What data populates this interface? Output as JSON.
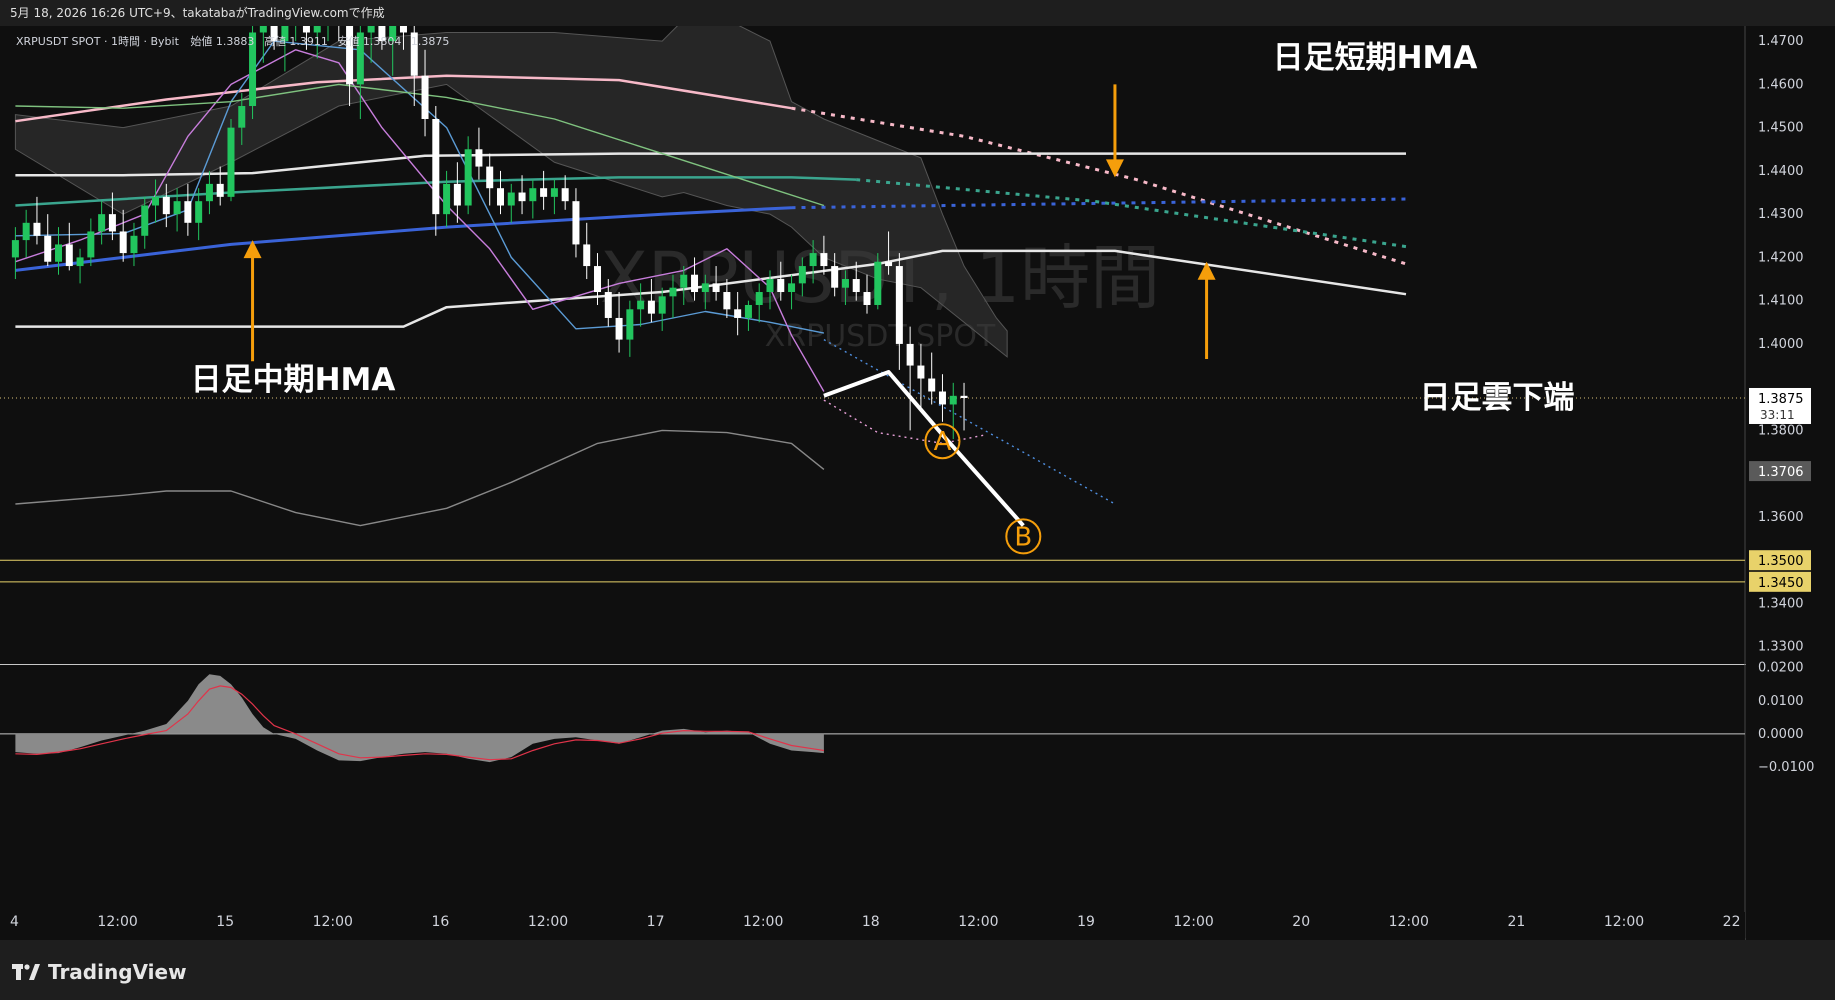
{
  "header": {
    "caption": "5月 18, 2026 16:26 UTC+9、takatabaがTradingView.comで作成",
    "legend_symbol": "XRPUSDT SPOT · 1時間 · Bybit",
    "legend_open_label": "始値",
    "legend_open": "1.3883",
    "legend_high_label": "高値",
    "legend_high": "1.3911",
    "legend_low_label": "安値",
    "legend_low": "1.3804",
    "legend_close": "1.3875"
  },
  "watermark": {
    "big": "XRPUSDT, 1時間",
    "small": "XRPUSDT SPOT"
  },
  "annotations": {
    "short_hma": "日足短期HMA",
    "mid_hma": "日足中期HMA",
    "cloud_bottom": "日足雲下端",
    "wave_a": "A",
    "wave_b": "B"
  },
  "brand": {
    "name": "TradingView"
  },
  "colors": {
    "background": "#0f0f0f",
    "up_candle": "#22c55e",
    "down_candle": "#ffffff",
    "short_hma": "#f7b9c8",
    "mid_hma": "#3a63d8",
    "teal_hma": "#3aa58e",
    "cloud": "#3a3a3a",
    "support": "#e8d26a",
    "arrow": "#f59e0b"
  },
  "chart_data": [
    {
      "type": "line",
      "title": "XRPUSDT, 1時間",
      "x_ticks": [
        "4",
        "12:00",
        "15",
        "12:00",
        "16",
        "12:00",
        "17",
        "12:00",
        "18",
        "12:00",
        "19",
        "12:00",
        "20",
        "12:00",
        "21",
        "12:00",
        "22"
      ],
      "y_ticks": [
        "1.4700",
        "1.4600",
        "1.4500",
        "1.4400",
        "1.4300",
        "1.4200",
        "1.4100",
        "1.4000",
        "1.3800",
        "1.3600",
        "1.3400",
        "1.3300"
      ],
      "ylim": [
        1.326,
        1.4735
      ],
      "price_labels": [
        {
          "value": 1.3875,
          "text": "1.3875",
          "sub": "33:11",
          "kind": "last"
        },
        {
          "value": 1.3706,
          "text": "1.3706",
          "kind": "gray"
        },
        {
          "value": 1.35,
          "text": "1.3500",
          "kind": "support"
        },
        {
          "value": 1.345,
          "text": "1.3450",
          "kind": "support"
        }
      ],
      "last_price": 1.3875,
      "support_levels": [
        1.35,
        1.345
      ],
      "candles": [
        [
          1.42,
          1.427,
          1.415,
          1.424
        ],
        [
          1.424,
          1.431,
          1.42,
          1.428
        ],
        [
          1.428,
          1.434,
          1.423,
          1.425
        ],
        [
          1.425,
          1.43,
          1.418,
          1.419
        ],
        [
          1.419,
          1.427,
          1.416,
          1.423
        ],
        [
          1.423,
          1.428,
          1.417,
          1.418
        ],
        [
          1.418,
          1.422,
          1.414,
          1.42
        ],
        [
          1.42,
          1.429,
          1.418,
          1.426
        ],
        [
          1.426,
          1.433,
          1.423,
          1.43
        ],
        [
          1.43,
          1.435,
          1.424,
          1.426
        ],
        [
          1.426,
          1.431,
          1.419,
          1.421
        ],
        [
          1.421,
          1.428,
          1.418,
          1.425
        ],
        [
          1.425,
          1.434,
          1.422,
          1.432
        ],
        [
          1.432,
          1.438,
          1.428,
          1.434
        ],
        [
          1.434,
          1.437,
          1.427,
          1.43
        ],
        [
          1.43,
          1.436,
          1.426,
          1.433
        ],
        [
          1.433,
          1.437,
          1.425,
          1.428
        ],
        [
          1.428,
          1.436,
          1.424,
          1.433
        ],
        [
          1.433,
          1.44,
          1.43,
          1.437
        ],
        [
          1.437,
          1.441,
          1.432,
          1.434
        ],
        [
          1.434,
          1.452,
          1.433,
          1.45
        ],
        [
          1.45,
          1.458,
          1.446,
          1.455
        ],
        [
          1.455,
          1.476,
          1.452,
          1.472
        ],
        [
          1.472,
          1.478,
          1.465,
          1.476
        ],
        [
          1.476,
          1.48,
          1.468,
          1.47
        ],
        [
          1.47,
          1.478,
          1.463,
          1.475
        ],
        [
          1.475,
          1.482,
          1.47,
          1.478
        ],
        [
          1.478,
          1.482,
          1.468,
          1.472
        ],
        [
          1.472,
          1.48,
          1.466,
          1.476
        ],
        [
          1.476,
          1.482,
          1.47,
          1.478
        ],
        [
          1.478,
          1.482,
          1.47,
          1.474
        ],
        [
          1.474,
          1.478,
          1.455,
          1.46
        ],
        [
          1.46,
          1.476,
          1.452,
          1.472
        ],
        [
          1.472,
          1.48,
          1.465,
          1.476
        ],
        [
          1.476,
          1.481,
          1.468,
          1.47
        ],
        [
          1.47,
          1.477,
          1.462,
          1.474
        ],
        [
          1.474,
          1.48,
          1.468,
          1.472
        ],
        [
          1.472,
          1.476,
          1.455,
          1.462
        ],
        [
          1.462,
          1.468,
          1.448,
          1.452
        ],
        [
          1.452,
          1.455,
          1.425,
          1.43
        ],
        [
          1.43,
          1.44,
          1.427,
          1.437
        ],
        [
          1.437,
          1.442,
          1.428,
          1.432
        ],
        [
          1.432,
          1.448,
          1.43,
          1.445
        ],
        [
          1.445,
          1.45,
          1.438,
          1.441
        ],
        [
          1.441,
          1.444,
          1.432,
          1.436
        ],
        [
          1.436,
          1.44,
          1.43,
          1.432
        ],
        [
          1.432,
          1.437,
          1.428,
          1.435
        ],
        [
          1.435,
          1.439,
          1.43,
          1.433
        ],
        [
          1.433,
          1.438,
          1.429,
          1.436
        ],
        [
          1.436,
          1.44,
          1.431,
          1.434
        ],
        [
          1.434,
          1.438,
          1.43,
          1.436
        ],
        [
          1.436,
          1.439,
          1.431,
          1.433
        ],
        [
          1.433,
          1.436,
          1.42,
          1.423
        ],
        [
          1.423,
          1.428,
          1.415,
          1.418
        ],
        [
          1.418,
          1.421,
          1.409,
          1.412
        ],
        [
          1.412,
          1.415,
          1.404,
          1.406
        ],
        [
          1.406,
          1.412,
          1.398,
          1.401
        ],
        [
          1.401,
          1.41,
          1.397,
          1.408
        ],
        [
          1.408,
          1.414,
          1.404,
          1.41
        ],
        [
          1.41,
          1.415,
          1.405,
          1.407
        ],
        [
          1.407,
          1.413,
          1.403,
          1.411
        ],
        [
          1.411,
          1.416,
          1.406,
          1.413
        ],
        [
          1.413,
          1.418,
          1.409,
          1.416
        ],
        [
          1.416,
          1.42,
          1.41,
          1.412
        ],
        [
          1.412,
          1.416,
          1.408,
          1.414
        ],
        [
          1.414,
          1.418,
          1.41,
          1.412
        ],
        [
          1.412,
          1.415,
          1.406,
          1.408
        ],
        [
          1.408,
          1.412,
          1.402,
          1.406
        ],
        [
          1.406,
          1.41,
          1.403,
          1.409
        ],
        [
          1.409,
          1.414,
          1.405,
          1.412
        ],
        [
          1.412,
          1.417,
          1.408,
          1.415
        ],
        [
          1.415,
          1.419,
          1.41,
          1.412
        ],
        [
          1.412,
          1.416,
          1.408,
          1.414
        ],
        [
          1.414,
          1.42,
          1.411,
          1.418
        ],
        [
          1.418,
          1.424,
          1.414,
          1.421
        ],
        [
          1.421,
          1.425,
          1.416,
          1.418
        ],
        [
          1.418,
          1.421,
          1.411,
          1.413
        ],
        [
          1.413,
          1.417,
          1.409,
          1.415
        ],
        [
          1.415,
          1.419,
          1.41,
          1.412
        ],
        [
          1.412,
          1.416,
          1.407,
          1.409
        ],
        [
          1.409,
          1.421,
          1.408,
          1.419
        ],
        [
          1.419,
          1.426,
          1.416,
          1.418
        ],
        [
          1.418,
          1.421,
          1.394,
          1.4
        ],
        [
          1.4,
          1.404,
          1.38,
          1.395
        ],
        [
          1.395,
          1.4,
          1.385,
          1.392
        ],
        [
          1.392,
          1.398,
          1.386,
          1.389
        ],
        [
          1.389,
          1.393,
          1.382,
          1.386
        ],
        [
          1.386,
          1.391,
          1.378,
          1.388
        ],
        [
          1.388,
          1.391,
          1.38,
          1.3875
        ]
      ],
      "series": [
        {
          "name": "",
          "color": "#f7b9c8",
          "style": "solid",
          "x": [
            0,
            14,
            28,
            40,
            56,
            72
          ],
          "y": [
            1.4515,
            1.4565,
            1.4605,
            1.462,
            1.461,
            1.4545
          ]
        },
        {
          "name": "",
          "color": "#f7b9c8",
          "style": "dotted",
          "x": [
            72,
            88,
            104,
            129
          ],
          "y": [
            1.4545,
            1.448,
            1.438,
            1.4185
          ]
        },
        {
          "name": "",
          "color": "#3a63d8",
          "style": "solid",
          "x": [
            0,
            20,
            40,
            60,
            72
          ],
          "y": [
            1.417,
            1.423,
            1.427,
            1.43,
            1.4315
          ]
        },
        {
          "name": "",
          "color": "#3a63d8",
          "style": "dotted",
          "x": [
            72,
            129
          ],
          "y": [
            1.4315,
            1.4335
          ]
        },
        {
          "name": "",
          "color": "#3aa58e",
          "style": "solid",
          "x": [
            0,
            20,
            40,
            56,
            72,
            78
          ],
          "y": [
            1.432,
            1.435,
            1.4375,
            1.4385,
            1.4385,
            1.438
          ]
        },
        {
          "name": "",
          "color": "#3aa58e",
          "style": "dotted",
          "x": [
            78,
            100,
            129
          ],
          "y": [
            1.438,
            1.433,
            1.4225
          ]
        },
        {
          "name": "",
          "color": "#e6e6e6",
          "style": "solid",
          "x": [
            0,
            20,
            36,
            40,
            60,
            80,
            86,
            102,
            129
          ],
          "y": [
            1.404,
            1.404,
            1.404,
            1.4085,
            1.412,
            1.4185,
            1.4215,
            1.4215,
            1.4115
          ]
        },
        {
          "name": "",
          "color": "#e6e6e6",
          "style": "solid",
          "x": [
            0,
            10,
            22,
            38,
            56,
            78,
            129
          ],
          "y": [
            1.439,
            1.439,
            1.4395,
            1.4435,
            1.444,
            1.444,
            1.444
          ]
        },
        {
          "name": "",
          "color": "#888888",
          "style": "solid",
          "x": [
            0,
            10,
            14,
            20,
            26,
            32,
            40,
            46,
            54,
            60,
            66,
            72,
            75
          ],
          "y": [
            1.363,
            1.365,
            1.366,
            1.366,
            1.361,
            1.358,
            1.362,
            1.368,
            1.377,
            1.38,
            1.3795,
            1.377,
            1.371
          ]
        },
        {
          "name": "",
          "color": "#5b9bd5",
          "style": "solid",
          "x": [
            0,
            10,
            16,
            20,
            24,
            32,
            40,
            46,
            52,
            58,
            64,
            70,
            75
          ],
          "y": [
            1.425,
            1.4255,
            1.431,
            1.456,
            1.47,
            1.468,
            1.45,
            1.42,
            1.4035,
            1.4045,
            1.4075,
            1.405,
            1.4025
          ]
        },
        {
          "name": "",
          "color": "#c77ddb",
          "style": "solid",
          "x": [
            0,
            6,
            12,
            16,
            20,
            26,
            30,
            34,
            40,
            44,
            48,
            52,
            56,
            62,
            66,
            70,
            72,
            75
          ],
          "y": [
            1.419,
            1.424,
            1.43,
            1.448,
            1.46,
            1.468,
            1.465,
            1.45,
            1.432,
            1.422,
            1.408,
            1.411,
            1.414,
            1.417,
            1.422,
            1.413,
            1.402,
            1.389
          ]
        },
        {
          "name": "",
          "color": "#7fc27f",
          "style": "solid",
          "x": [
            0,
            10,
            20,
            30,
            40,
            50,
            60,
            70,
            75
          ],
          "y": [
            1.455,
            1.4545,
            1.456,
            1.46,
            1.457,
            1.452,
            1.444,
            1.436,
            1.432
          ]
        }
      ],
      "cloud_upper": {
        "x": [
          0,
          10,
          20,
          30,
          40,
          50,
          60,
          62,
          66,
          70,
          72,
          75,
          80,
          84,
          86,
          88,
          90,
          91,
          92
        ],
        "y": [
          1.453,
          1.45,
          1.455,
          1.47,
          1.472,
          1.472,
          1.47,
          1.475,
          1.475,
          1.47,
          1.456,
          1.452,
          1.447,
          1.443,
          1.43,
          1.418,
          1.41,
          1.406,
          1.403
        ]
      },
      "cloud_lower": {
        "x": [
          0,
          10,
          20,
          30,
          40,
          50,
          60,
          62,
          66,
          70,
          72,
          75,
          80,
          84,
          86,
          88,
          90,
          91,
          92
        ],
        "y": [
          1.445,
          1.43,
          1.442,
          1.455,
          1.46,
          1.442,
          1.434,
          1.435,
          1.432,
          1.43,
          1.427,
          1.42,
          1.415,
          1.413,
          1.409,
          1.405,
          1.401,
          1.399,
          1.397
        ]
      },
      "projection": {
        "x": [
          75,
          81,
          86,
          93.5
        ],
        "y": [
          1.388,
          1.3935,
          1.379,
          1.358
        ]
      },
      "trend_dotted": {
        "x": [
          75,
          102
        ],
        "y": [
          1.401,
          1.363
        ]
      },
      "arc_a": {
        "x": [
          75,
          80,
          86,
          90
        ],
        "y": [
          1.387,
          1.3795,
          1.377,
          1.379
        ]
      },
      "wave_points": [
        {
          "label": "A",
          "x": 86,
          "y": 1.3775
        },
        {
          "label": "B",
          "x": 93.5,
          "y": 1.3555
        }
      ],
      "arrows": [
        {
          "label_key": "short_hma",
          "x": 102,
          "y_tip": 1.4385,
          "y_tail": 1.46
        },
        {
          "label_key": "mid_hma",
          "x": 22,
          "y_tip": 1.424,
          "y_tail": 1.396
        },
        {
          "label_key": "cloud_bottom",
          "x": 110.5,
          "y_tip": 1.419,
          "y_tail": 1.3965
        }
      ]
    },
    {
      "type": "area",
      "title": "",
      "y_ticks": [
        "0.0200",
        "0.0100",
        "0.0000",
        "−0.0100"
      ],
      "ylim": [
        -0.0115,
        0.0205
      ],
      "x": [
        0,
        2,
        4,
        6,
        8,
        10,
        12,
        14,
        16,
        17,
        18,
        19,
        20,
        21,
        22,
        23,
        24,
        26,
        28,
        30,
        32,
        34,
        36,
        38,
        40,
        42,
        44,
        46,
        48,
        50,
        52,
        54,
        56,
        58,
        60,
        62,
        64,
        66,
        68,
        70,
        72,
        74,
        75
      ],
      "values": [
        -0.0055,
        -0.006,
        -0.0058,
        -0.004,
        -0.002,
        -0.0005,
        0.001,
        0.003,
        0.01,
        0.015,
        0.018,
        0.0175,
        0.015,
        0.011,
        0.006,
        0.002,
        0.0,
        -0.0015,
        -0.005,
        -0.008,
        -0.0082,
        -0.007,
        -0.006,
        -0.0055,
        -0.006,
        -0.0075,
        -0.0085,
        -0.007,
        -0.003,
        -0.0015,
        -0.001,
        -0.002,
        -0.003,
        -0.001,
        0.001,
        0.0015,
        0.0005,
        0.001,
        0.0005,
        -0.003,
        -0.005,
        -0.0055,
        -0.0058
      ],
      "signal": [
        -0.006,
        -0.0062,
        -0.0055,
        -0.0045,
        -0.003,
        -0.0015,
        -0.0002,
        0.001,
        0.006,
        0.01,
        0.0135,
        0.0145,
        0.014,
        0.012,
        0.009,
        0.0055,
        0.0025,
        0.0,
        -0.003,
        -0.006,
        -0.0072,
        -0.007,
        -0.0065,
        -0.006,
        -0.0062,
        -0.007,
        -0.0078,
        -0.0075,
        -0.005,
        -0.003,
        -0.0018,
        -0.002,
        -0.0028,
        -0.0015,
        0.0002,
        0.001,
        0.0008,
        0.0008,
        0.0006,
        -0.0015,
        -0.0035,
        -0.0045,
        -0.005
      ],
      "colors": {
        "fill": "#8a8a8a",
        "signal": "#e0344a"
      }
    }
  ]
}
